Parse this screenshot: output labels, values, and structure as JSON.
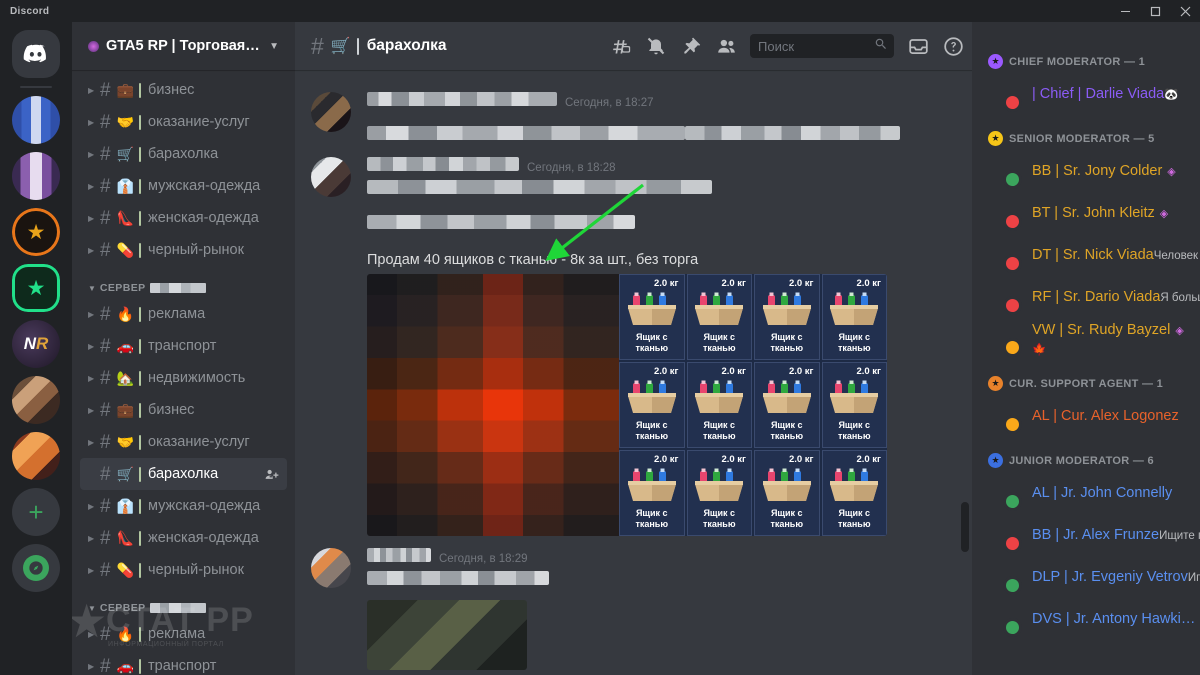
{
  "window": {
    "app_name": "Discord",
    "minimize": "–",
    "maximize": "❐",
    "close": "✕"
  },
  "guild_rail": {
    "home_tooltip": "Discord",
    "add_server_label": "+",
    "explore_label": "compass-icon",
    "guilds": [
      {
        "name": "guild-blue",
        "selected": false
      },
      {
        "name": "guild-purple",
        "selected": false
      },
      {
        "name": "guild-orange-star",
        "selected": false
      },
      {
        "name": "guild-green-star",
        "selected": true
      },
      {
        "name": "guild-nr",
        "selected": false
      },
      {
        "name": "guild-pixel-a",
        "selected": false
      },
      {
        "name": "guild-pixel-b",
        "selected": false
      }
    ]
  },
  "server": {
    "name": "GTA5 RP | Торговая п...",
    "chevron": "⌵"
  },
  "sidebar": {
    "categories": [
      {
        "label": "",
        "redacted": false,
        "hidden_header": true,
        "channels": [
          {
            "emoji": "💼",
            "name": "бизнес",
            "active": false
          },
          {
            "emoji": "🤝",
            "name": "оказание-услуг",
            "active": false
          },
          {
            "emoji": "🛒",
            "name": "барахолка",
            "active": false
          },
          {
            "emoji": "👔",
            "name": "мужская-одежда",
            "active": false
          },
          {
            "emoji": "👠",
            "name": "женская-одежда",
            "active": false
          },
          {
            "emoji": "💊",
            "name": "черный-рынок",
            "active": false
          }
        ]
      },
      {
        "label": "СЕРВЕР",
        "redacted": true,
        "hidden_header": false,
        "channels": [
          {
            "emoji": "🔥",
            "name": "реклама",
            "active": false
          },
          {
            "emoji": "🚗",
            "name": "транспорт",
            "active": false
          },
          {
            "emoji": "🏡",
            "name": "недвижимость",
            "active": false
          },
          {
            "emoji": "💼",
            "name": "бизнес",
            "active": false
          },
          {
            "emoji": "🤝",
            "name": "оказание-услуг",
            "active": false
          },
          {
            "emoji": "🛒",
            "name": "барахолка",
            "active": true
          },
          {
            "emoji": "👔",
            "name": "мужская-одежда",
            "active": false
          },
          {
            "emoji": "👠",
            "name": "женская-одежда",
            "active": false
          },
          {
            "emoji": "💊",
            "name": "черный-рынок",
            "active": false
          }
        ]
      },
      {
        "label": "СЕРВЕР",
        "redacted": true,
        "hidden_header": false,
        "channels": [
          {
            "emoji": "🔥",
            "name": "реклама",
            "active": false
          },
          {
            "emoji": "🚗",
            "name": "транспорт",
            "active": false
          }
        ]
      }
    ]
  },
  "watermark": {
    "text": "СТАТ РР",
    "subtext": "ИНФОРМАЦИОННЫЙ ПОРТАЛ"
  },
  "channel_header": {
    "emoji": "🛒",
    "title": "барахолка"
  },
  "toolbar": {
    "threads_label": "threads-icon",
    "notifications_label": "bell-muted-icon",
    "pinned_label": "pin-icon",
    "members_label": "members-icon",
    "inbox_label": "inbox-icon",
    "help_label": "help-icon"
  },
  "search": {
    "placeholder": "Поиск",
    "value": ""
  },
  "messages": [
    {
      "author_redacted": true,
      "timestamp": "Сегодня, в 18:27",
      "lines_redacted": 2,
      "text": ""
    },
    {
      "author_redacted": true,
      "timestamp": "Сегодня, в 18:28",
      "lines_redacted": 2,
      "text": "Продам 40 ящиков с тканью - 8к за шт., без торга"
    },
    {
      "author_redacted": true,
      "timestamp": "Сегодня, в 18:29",
      "lines_redacted": 1,
      "text": ""
    }
  ],
  "annotation": {
    "type": "green-arrow",
    "color": "#1fd638",
    "points_to": "Продам 40 ящиков с тканью - 8к за шт., без торга"
  },
  "inventory": {
    "weight_label": "2.0 кг",
    "item_name": "Ящик с тканью",
    "rows": 3,
    "columns": 4,
    "cells": [
      {
        "weight": "2.0 кг",
        "name": "Ящик с тканью"
      },
      {
        "weight": "2.0 кг",
        "name": "Ящик с тканью"
      },
      {
        "weight": "2.0 кг",
        "name": "Ящик с тканью"
      },
      {
        "weight": "2.0 кг",
        "name": "Ящик с тканью"
      },
      {
        "weight": "2.0 кг",
        "name": "Ящик с тканью"
      },
      {
        "weight": "2.0 кг",
        "name": "Ящик с тканью"
      },
      {
        "weight": "2.0 кг",
        "name": "Ящик с тканью"
      },
      {
        "weight": "2.0 кг",
        "name": "Ящик с тканью"
      },
      {
        "weight": "2.0 кг",
        "name": "Ящик с тканью"
      },
      {
        "weight": "2.0 кг",
        "name": "Ящик с тканью"
      },
      {
        "weight": "2.0 кг",
        "name": "Ящик с тканью"
      },
      {
        "weight": "2.0 кг",
        "name": "Ящик с тканью"
      }
    ]
  },
  "member_list": {
    "groups": [
      {
        "label": "CHIEF MODERATOR — 1",
        "badge_color": "#9b59ff",
        "members": [
          {
            "name": "| Chief | Darlie Viada",
            "color": "#8b5cf6",
            "status": "dnd",
            "subtext": "🐼",
            "subtext_is_emoji": true,
            "badge": "",
            "avatar": "avatar-blonde"
          }
        ]
      },
      {
        "label": "SENIOR MODERATOR — 5",
        "badge_color": "#f5c518",
        "members": [
          {
            "name": "BB | Sr. Jony Colder",
            "color": "#e0a526",
            "status": "online",
            "subtext": "",
            "badge": "◈",
            "avatar": "avatar-dark"
          },
          {
            "name": "BT | Sr. John Kleitz",
            "color": "#e0a526",
            "status": "dnd",
            "subtext": "",
            "badge": "◈",
            "avatar": "avatar-anime"
          },
          {
            "name": "DT | Sr. Nick Viada",
            "color": "#e0a526",
            "status": "dnd",
            "subtext": "Человек с неограниченным…",
            "badge": "",
            "avatar": "avatar-floral"
          },
          {
            "name": "RF | Sr. Dario Viada",
            "color": "#e0a526",
            "status": "dnd",
            "subtext": "Я больше никому теперь не …",
            "badge": "",
            "avatar": "avatar-gray"
          },
          {
            "name": "VW | Sr. Rudy Bayzel",
            "color": "#e0a526",
            "status": "idle",
            "subtext": "🍁",
            "subtext_is_emoji": true,
            "badge": "◈",
            "avatar": "avatar-red-floral"
          }
        ]
      },
      {
        "label": "CUR. SUPPORT AGENT — 1",
        "badge_color": "#e8822b",
        "members": [
          {
            "name": "AL | Cur. Alex Logonez",
            "color": "#e8622b",
            "status": "idle",
            "subtext": "",
            "badge": "",
            "avatar": "avatar-moon"
          }
        ]
      },
      {
        "label": "JUNIOR MODERATOR — 6",
        "badge_color": "#3b6fe0",
        "members": [
          {
            "name": "AL | Jr. John Connelly",
            "color": "#5a8ff0",
            "status": "online",
            "subtext": "",
            "badge": "",
            "avatar": "avatar-suit"
          },
          {
            "name": "BB | Jr. Alex Frunze",
            "color": "#5a8ff0",
            "status": "dnd",
            "subtext": "Ищите правды, она Вас сдел…",
            "badge": "",
            "avatar": "avatar-cartoon"
          },
          {
            "name": "DLP | Jr. Evgeniy Vetrov",
            "color": "#5a8ff0",
            "status": "online",
            "subtext": "Играет в RAGE Multiplayer",
            "badge": "",
            "avatar": "avatar-kid"
          },
          {
            "name": "DVS | Jr. Antony Hawki…",
            "color": "#5a8ff0",
            "status": "online",
            "subtext": "",
            "badge": "",
            "avatar": "avatar-dark2"
          }
        ]
      }
    ]
  }
}
